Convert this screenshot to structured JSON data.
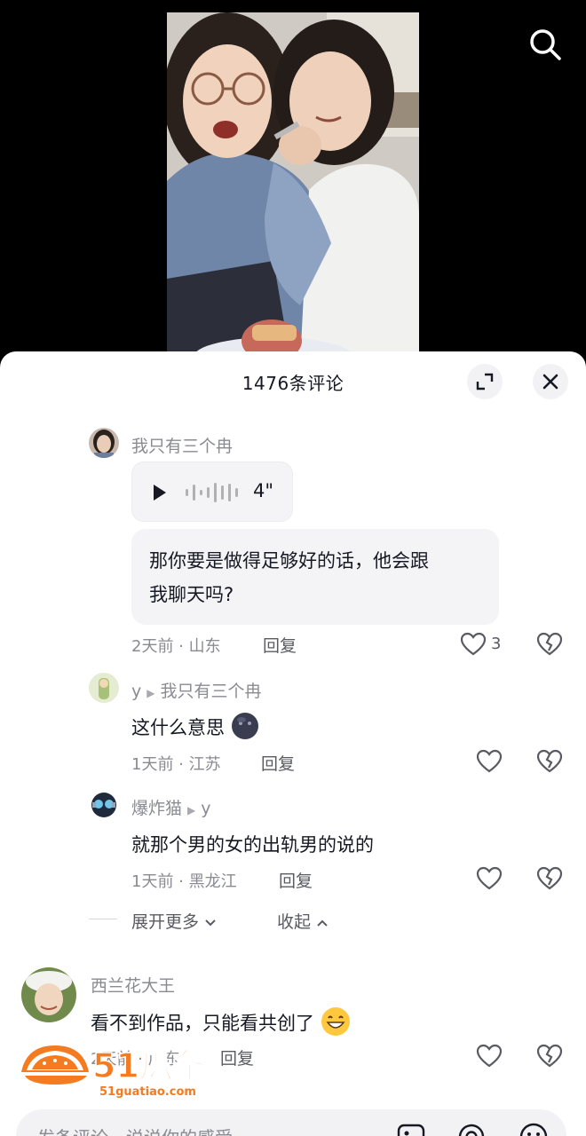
{
  "header": {
    "comment_count_title": "1476条评论"
  },
  "comments": [
    {
      "user": "我只有三个冉",
      "voice_duration": "4\"",
      "text_line1": "那你要是做得足够好的话，他会跟",
      "text_line2": "我聊天吗?",
      "time_location": "2天前 · 山东",
      "reply_label": "回复",
      "likes": "3"
    },
    {
      "user": "y",
      "reply_to": "我只有三个冉",
      "text": "这什么意思",
      "emoji_icon": "dark-face-emoji-icon",
      "time_location": "1天前 · 江苏",
      "reply_label": "回复"
    },
    {
      "user": "爆炸猫",
      "reply_to": "y",
      "text": "就那个男的女的出轨男的说的",
      "time_location": "1天前 · 黑龙江",
      "reply_label": "回复"
    },
    {
      "user": "西兰花大王",
      "text": "看不到作品，只能看共创了",
      "emoji_icon": "grin-emoji-icon",
      "time_location": "2天前 · 广东",
      "reply_label": "回复"
    }
  ],
  "thread_controls": {
    "expand_more": "展开更多",
    "collapse": "收起"
  },
  "input": {
    "placeholder": "发条评论，说说你的感受"
  },
  "watermark": {
    "brand": "51瓜条",
    "url": "51guatiao.com"
  },
  "colors": {
    "accent_orange": "#f47b20",
    "text_primary": "#161823",
    "text_secondary": "#8a8b91"
  }
}
